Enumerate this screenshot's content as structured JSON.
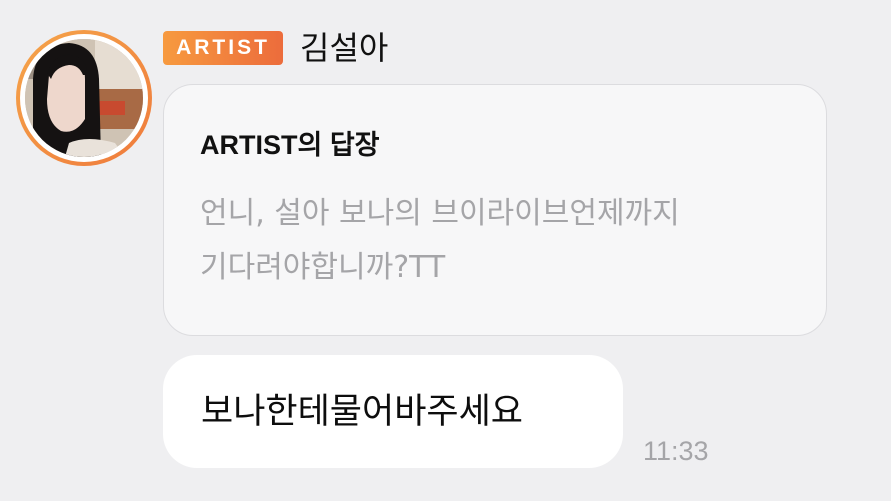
{
  "sender": {
    "badge": "ARTIST",
    "name": "김설아"
  },
  "reply": {
    "title": "ARTIST의 답장",
    "body_lines": [
      "언니, 설아 보나의 브이라이브언제까지",
      "기다려야합니까?TT"
    ]
  },
  "message": {
    "text": "보나한테물어바주세요",
    "time": "11:33"
  },
  "colors": {
    "background": "#efeff1",
    "badge_gradient_start": "#f79a3f",
    "badge_gradient_end": "#ec6c3c",
    "reply_card": "#f7f7f8",
    "muted_text": "#a5a5a8",
    "bubble": "#ffffff"
  }
}
